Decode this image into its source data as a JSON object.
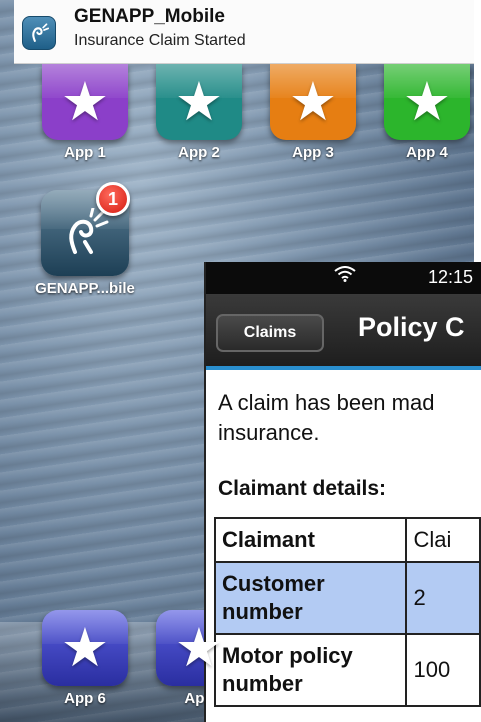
{
  "banner": {
    "app_name": "GENAPP_Mobile",
    "message": "Insurance Claim Started",
    "icon": "genapp-icon"
  },
  "home": {
    "top_apps": [
      {
        "label": "App 1",
        "color": "#8b3fc9",
        "icon": "star-icon"
      },
      {
        "label": "App 2",
        "color": "#1f8a86",
        "icon": "star-icon"
      },
      {
        "label": "App 3",
        "color": "#e67e12",
        "icon": "star-icon"
      },
      {
        "label": "App 4",
        "color": "#2cb52c",
        "icon": "star-icon"
      }
    ],
    "genapp": {
      "label": "GENAPP...bile",
      "badge": "1",
      "icon": "genapp-icon"
    },
    "dock_apps": [
      {
        "label": "App 6",
        "color": "#3b3fbf",
        "icon": "star-icon"
      },
      {
        "label": "App",
        "color": "#3b3fbf",
        "icon": "star-icon"
      }
    ]
  },
  "window": {
    "status_time": "12:15",
    "back_label": "Claims",
    "title": "Policy C",
    "message": "A claim has been mad insurance.",
    "section_title": "Claimant details:",
    "table": [
      {
        "key": "Claimant",
        "value": "Clai",
        "highlight": false
      },
      {
        "key": "Customer number",
        "value": "2",
        "highlight": true
      },
      {
        "key": "Motor policy number",
        "value": "100",
        "highlight": false
      }
    ],
    "accent_color": "#2a8fcf"
  }
}
